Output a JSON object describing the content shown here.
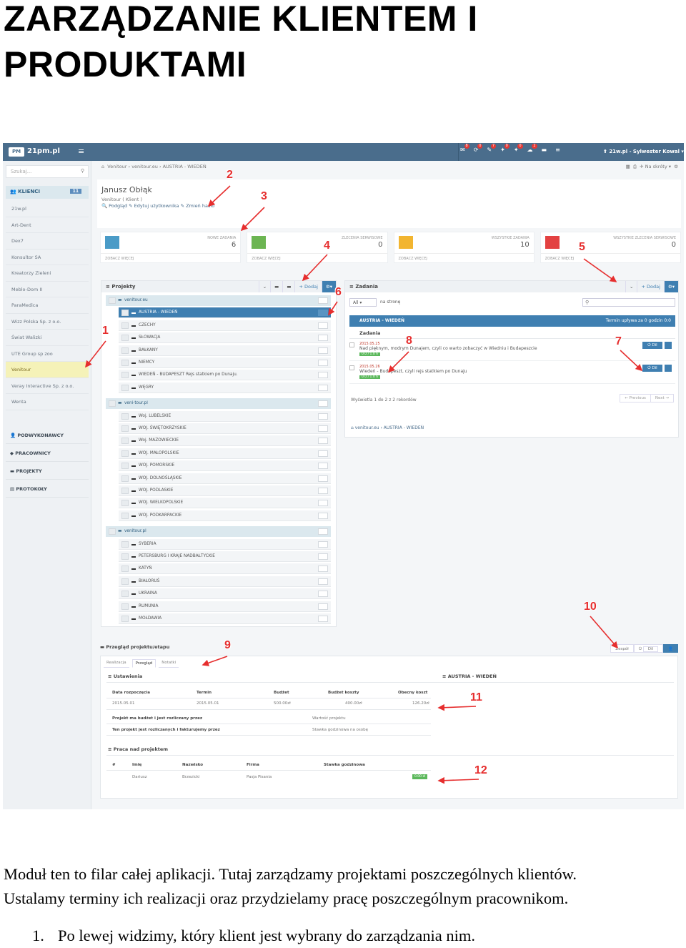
{
  "document": {
    "title_line1": "ZARZĄDZANIE KLIENTEM I",
    "title_line2": "PRODUKTAMI",
    "paragraph_line1": "Moduł ten to filar całej aplikacji. Tutaj zarządzamy projektami poszczególnych klientów.",
    "paragraph_line2": "Ustalamy terminy ich realizacji oraz przydzielamy pracę poszczególnym pracownikom.",
    "list": [
      {
        "number": "1.",
        "text": "Po lewej widzimy, który klient jest wybrany do zarządzania nim."
      }
    ]
  },
  "app": {
    "logo": "21pm.pl",
    "user": "21w.pl - Sylwester Kowal",
    "badges": [
      "8",
      "0",
      "7",
      "0",
      "0",
      "2"
    ],
    "search_placeholder": "Szukaj...",
    "clients_label": "KLIENCI",
    "clients_count": "11",
    "clients": [
      "21w.pl",
      "Art-Dent",
      "Dex7",
      "Konsultor SA",
      "Kreatorzy Zieleni",
      "Meblo-Dom II",
      "ParaMedica",
      "Wizz Polska Sp. z o.o.",
      "Świat Walizki",
      "UTE Group sp zoo",
      "Venitour",
      "Veray Interactive Sp. z o.o.",
      "Wenta"
    ],
    "active_client_index": 10,
    "sections": [
      "PODWYKONAWCY",
      "PRACOWNICY",
      "PROJEKTY",
      "PROTOKOŁY"
    ],
    "breadcrumb": "Venitour  ›  venitour.eu  ›  AUSTRIA - WIEDEŃ",
    "crumb_right": "Na skróty",
    "client_name": "Janusz Obłąk",
    "client_sub": "Venitour ( Klient )",
    "client_links": "Podgląd  ✎ Edytuj użytkownika  ✎ Zmień hasło",
    "stats": [
      {
        "label": "NOWE ZADANIA",
        "value": "6",
        "more": "ZOBACZ WIĘCEJ",
        "color": "#4a9bc7"
      },
      {
        "label": "ZLECENIA SERWISOWE",
        "value": "0",
        "more": "ZOBACZ WIĘCEJ",
        "color": "#6cb552"
      },
      {
        "label": "WSZYSTKIE ZADANIA",
        "value": "10",
        "more": "ZOBACZ WIĘCEJ",
        "color": "#f2b530"
      },
      {
        "label": "WSZYSTKIE ZLECENIA SERWISOWE",
        "value": "0",
        "more": "ZOBACZ WIĘCEJ",
        "color": "#e34141"
      }
    ],
    "projects": {
      "title": "Projekty",
      "add": "+ Dodaj",
      "groups": [
        {
          "name": "venitour.eu",
          "children": [
            "AUSTRIA - WIEDEŃ",
            "CZECHY",
            "SŁOWACJA",
            "BAŁKANY",
            "NIEMCY",
            "WIEDEŃ - BUDAPESZT Rejs statkiem po Dunaju.",
            "WĘGRY"
          ]
        },
        {
          "name": "veni-tour.pl",
          "children": [
            "Woj. LUBELSKIE",
            "WOJ. ŚWIĘTOKRZYSKIE",
            "Woj. MAZOWIECKIE",
            "WOJ. MAŁOPOLSKIE",
            "WOJ. POMORSKIE",
            "WOJ. DOLNOŚLĄSKIE",
            "WOJ. PODLASKIE",
            "WOJ. WIELKOPOLSKIE",
            "WOJ. PODKARPACKIE"
          ]
        },
        {
          "name": "venitour.pl",
          "children": [
            "SYBERIA",
            "PETERSBURG I KRAJE NADBAŁTYCKIE",
            "KATYŃ",
            "BIAŁORUŚ",
            "UKRAINA",
            "RUMUNIA",
            "MOŁDAWIA"
          ]
        }
      ]
    },
    "tasks": {
      "title": "Zadania",
      "add": "+ Dodaj",
      "all": "All",
      "per_page": "na stronę",
      "band_title": "AUSTRIA - WIEDEŃ",
      "band_right": "Termin upływa za 0 godzin 0:0",
      "column": "Zadania",
      "rows": [
        {
          "date": "2015.05.25",
          "text": "Nad pięknym, modrym Dunajem, czyli co warto zobaczyć w Wiedniu i Budapeszcie",
          "tag": "0.0 / 1.0 h",
          "btn": "⏻ Dil"
        },
        {
          "date": "2015.05.26",
          "text": "Wiedeń - Budapeszt, czyli rejs statkiem po Dunaju",
          "tag": "0.0 / 1.0 h",
          "btn": "⏻ Dil"
        }
      ],
      "showing": "Wyświetla 1 do 2 z 2 rekordów",
      "prev": "← Previous",
      "next": "Next →",
      "footer": "venitour.eu  ›  AUSTRIA - WIEDEŃ"
    },
    "overview": {
      "title": "Przegląd projektu/etapu",
      "right_buttons": [
        "Zespół",
        "Dil",
        "👤"
      ],
      "tabs": [
        "Realizacja",
        "Przegląd",
        "Notatki"
      ],
      "settings": "Ustawienia",
      "project_name": "AUSTRIA - WIEDEŃ",
      "headers": [
        "Data rozpoczęcia",
        "Termin",
        "Budżet",
        "Budżet koszty",
        "Obecny koszt"
      ],
      "values": [
        "2015.05.01",
        "2015.05.01",
        "500.00zł",
        "400.00zł",
        "126.20zł"
      ],
      "budget_label": "Projekt ma budżet i jest rozliczany przez",
      "budget_value": "Wartość projektu",
      "billing_label": "Ten projekt jest rozliczanych i fakturujemy przez",
      "billing_value": "Stawka godzinowa na osobę",
      "work_title": "Praca nad projektem",
      "work_headers": [
        "#",
        "Imię",
        "Nazwisko",
        "Firma",
        "Stawka godzinowa"
      ],
      "work_row": [
        "",
        "Dariusz",
        "Brzezicki",
        "Pasja Pisania",
        "0.00 zł"
      ]
    },
    "annotations": [
      "1",
      "2",
      "3",
      "4",
      "5",
      "6",
      "7",
      "8",
      "9",
      "10",
      "11",
      "12"
    ]
  }
}
